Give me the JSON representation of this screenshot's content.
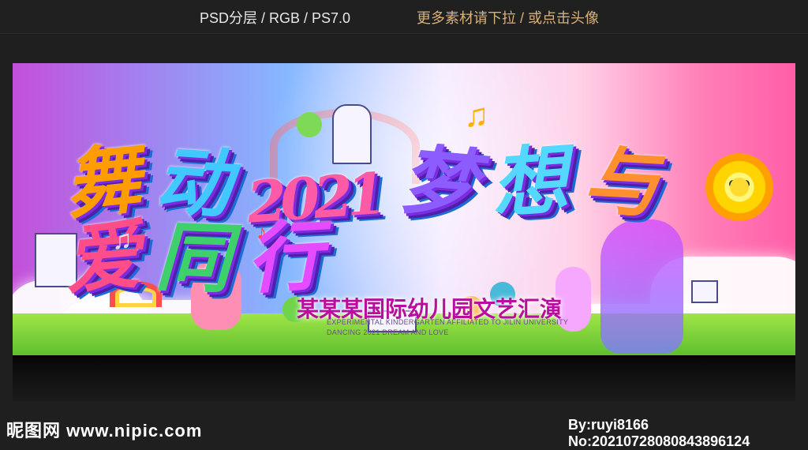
{
  "header": {
    "left_text": "PSD分层 / RGB / PS7.0",
    "right_text": "更多素材请下拉 / 或点击头像"
  },
  "banner": {
    "title_parts": [
      "舞",
      "动",
      "2021",
      "梦",
      "想",
      "与",
      "爱",
      "同",
      "行"
    ],
    "subtitle": "某某某国际幼儿园文艺汇演",
    "english_line1": "EXPERIMENTAL KINDERGARTEN AFFILIATED TO JILIN UNIVERSITY",
    "english_line2": "DANCING 2021 DREAM AND LOVE"
  },
  "footer": {
    "site_watermark": "昵图网 www.nipic.com",
    "author_watermark": "By:ruyi8166 No:20210728080843896124"
  },
  "decor": {
    "icons": [
      "sun-icon",
      "music-note-icon",
      "rainbow-icon",
      "castle-icon",
      "dancer-silhouette-icon",
      "drummer-bear-icon",
      "little-dancer-icon",
      "tree-icon"
    ]
  },
  "colors": {
    "background": "#1f1f1f",
    "subtitle": "#b80d9d",
    "sun": "#ffd400",
    "grass": "#6fcf35"
  }
}
